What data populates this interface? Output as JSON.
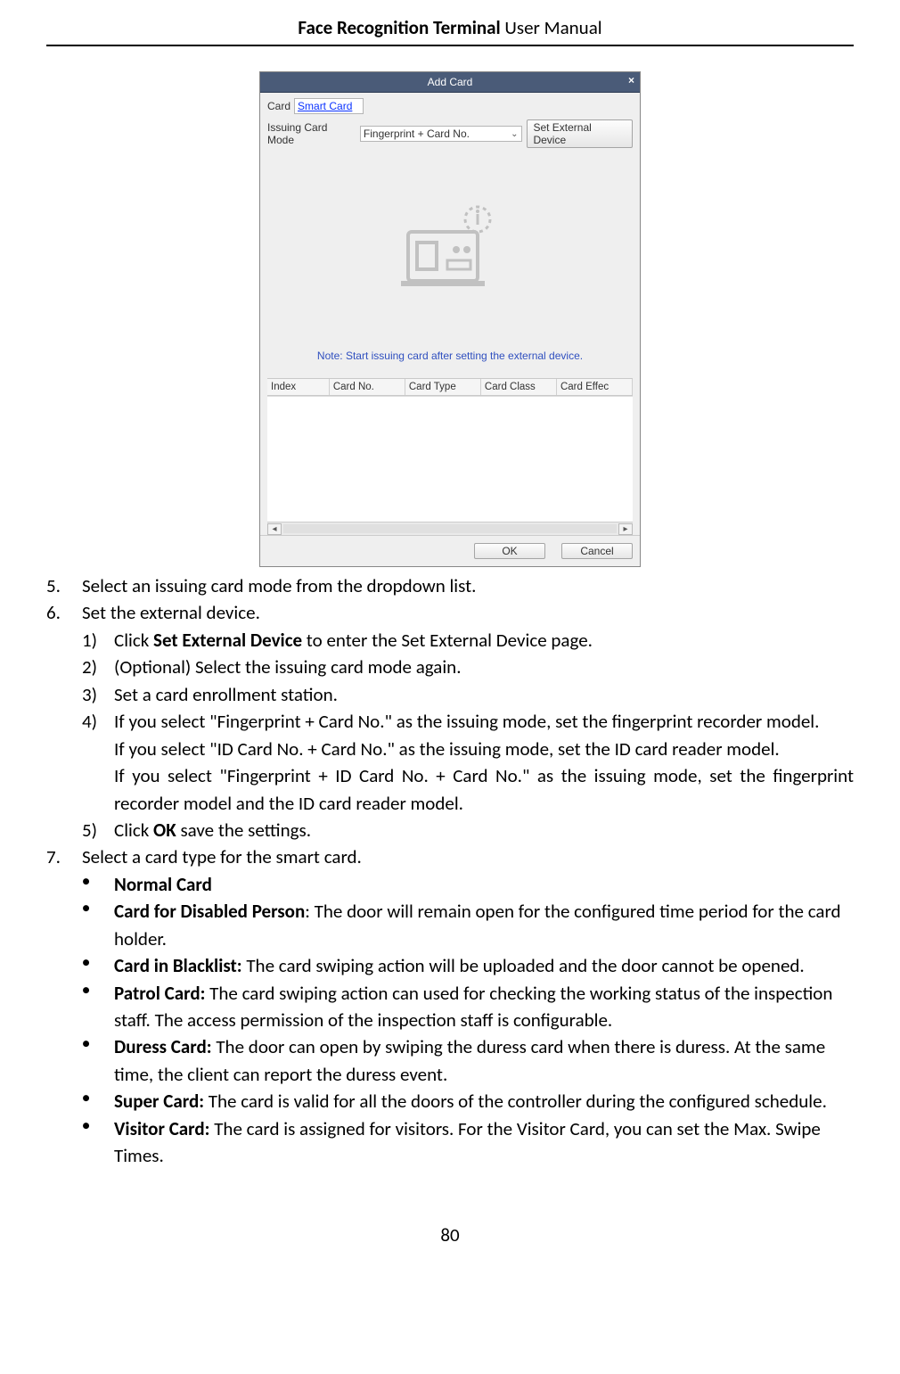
{
  "header": {
    "bold": "Face Recognition Terminal",
    "rest": " User Manual"
  },
  "dialog": {
    "title": "Add Card",
    "close": "×",
    "card_label": "Card",
    "card_value": "Smart Card",
    "mode_label": "Issuing Card Mode",
    "mode_value": "Fingerprint + Card No.",
    "set_ext_btn": "Set External Device",
    "note": "Note: Start issuing card after setting the external device.",
    "columns": [
      "Index",
      "Card No.",
      "Card Type",
      "Card Class",
      "Card Effec"
    ],
    "ok": "OK",
    "cancel": "Cancel"
  },
  "steps": {
    "s5": "Select an issuing card mode from the dropdown list.",
    "s6": "Set the external device.",
    "s6_1_a": "Click ",
    "s6_1_bold": "Set External Device",
    "s6_1_b": " to enter the Set External Device page.",
    "s6_2": "(Optional) Select the issuing card mode again.",
    "s6_3": "Set a card enrollment station.",
    "s6_4_a": "If you select \"Fingerprint + Card No.\" as the issuing mode, set the fingerprint recorder model.",
    "s6_4_b": "If you select \"ID Card No. + Card No.\" as the issuing mode, set the ID card reader model.",
    "s6_4_c": "If you select \"Fingerprint + ID Card No. + Card No.\" as the issuing mode, set the fingerprint recorder model and the ID card reader model.",
    "s6_5_a": "Click ",
    "s6_5_bold": "OK",
    "s6_5_b": " save the settings.",
    "s7": "Select a card type for the smart card."
  },
  "cards": {
    "normal_b": "Normal Card",
    "disabled_b": "Card for Disabled Person",
    "disabled_t": ": The door will remain open for the configured time period for the card holder.",
    "blacklist_b": "Card in Blacklist:",
    "blacklist_t": " The card swiping action will be uploaded and the door cannot be opened.",
    "patrol_b": "Patrol Card:",
    "patrol_t": " The card swiping action can used for checking the working status of the inspection staff. The access permission of the inspection staff is configurable.",
    "duress_b": "Duress Card:",
    "duress_t": " The door can open by swiping the duress card when there is duress. At the same time, the client can report the duress event.",
    "super_b": "Super Card:",
    "super_t": " The card is valid for all the doors of the controller during the configured schedule.",
    "visitor_b": "Visitor Card:",
    "visitor_t": " The card is assigned for visitors. For the Visitor Card, you can set the Max. Swipe Times."
  },
  "page_number": "80"
}
